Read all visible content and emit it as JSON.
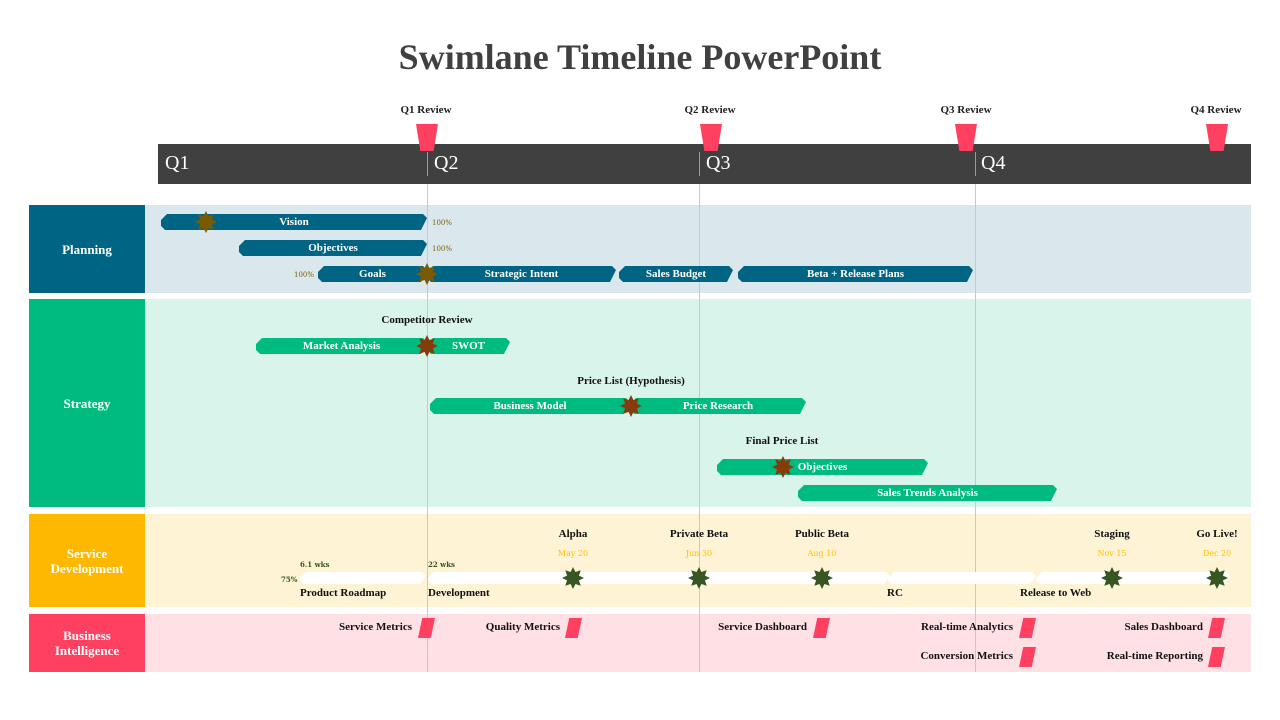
{
  "title": "Swimlane Timeline PowerPoint",
  "colors": {
    "header_bar": "#404040",
    "review_flag": "#ff4060",
    "planning": "#006584",
    "planning_bg": "#dae8ed",
    "strategy": "#00bb80",
    "strategy_bg": "#d9f4ea",
    "service": "#ffb800",
    "service_bg": "#fff3d6",
    "bi": "#ff4060",
    "bi_bg": "#ffe0e4"
  },
  "quarters": [
    "Q1",
    "Q2",
    "Q3",
    "Q4"
  ],
  "reviews": [
    "Q1 Review",
    "Q2 Review",
    "Q3 Review",
    "Q4 Review"
  ],
  "lanes": {
    "planning": {
      "label": "Planning",
      "bars": [
        "Vision",
        "Objectives",
        "Goals",
        "Strategic Intent",
        "Sales Budget",
        "Beta + Release Plans"
      ],
      "percents": [
        "100%",
        "100%",
        "100%"
      ]
    },
    "strategy": {
      "label": "Strategy",
      "milestones": [
        "Competitor Review",
        "Price List (Hypothesis)",
        "Final Price List"
      ],
      "bars": [
        "Market Analysis",
        "SWOT",
        "Business Model",
        "Price Research",
        "Objectives",
        "Sales Trends Analysis"
      ]
    },
    "service": {
      "label": "Service Development",
      "label_line1": "Service",
      "label_line2": "Development",
      "progress": "75%",
      "durations": [
        "6.1 wks",
        "22 wks"
      ],
      "tasks": [
        "Product Roadmap",
        "Development",
        "RC",
        "Release to Web"
      ],
      "milestones": [
        {
          "label": "Alpha",
          "date": "May 20"
        },
        {
          "label": "Private Beta",
          "date": "Jun 30"
        },
        {
          "label": "Public Beta",
          "date": "Aug 10"
        },
        {
          "label": "Staging",
          "date": "Nov 15"
        },
        {
          "label": "Go Live!",
          "date": "Dec 20"
        }
      ]
    },
    "bi": {
      "label": "Business Intelligence",
      "label_line1": "Business",
      "label_line2": "Intelligence",
      "items": [
        "Service Metrics",
        "Quality Metrics",
        "Service Dashboard",
        "Real-time Analytics",
        "Sales Dashboard",
        "Conversion Metrics",
        "Real-time Reporting"
      ]
    }
  }
}
